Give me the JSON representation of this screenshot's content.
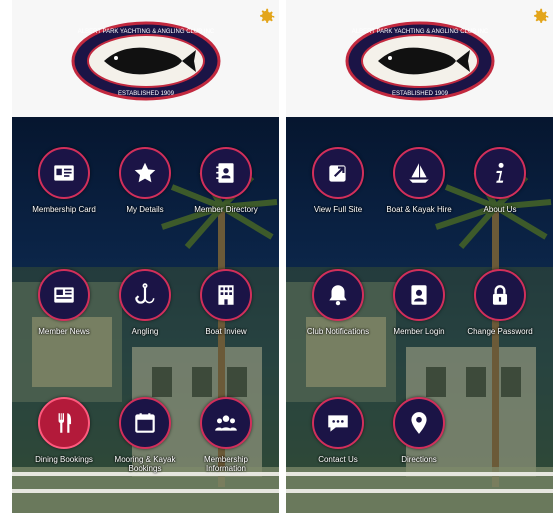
{
  "left_screen": {
    "tiles": [
      {
        "label": "Membership Card",
        "icon": "id-card-icon"
      },
      {
        "label": "My Details",
        "icon": "star-icon"
      },
      {
        "label": "Member Directory",
        "icon": "address-book-icon"
      },
      {
        "label": "Member News",
        "icon": "newspaper-icon"
      },
      {
        "label": "Angling",
        "icon": "fishing-hook-icon"
      },
      {
        "label": "Boat Inview",
        "icon": "building-icon"
      },
      {
        "label": "Dining Bookings",
        "icon": "fork-knife-icon"
      },
      {
        "label": "Mooring & Kayak Bookings",
        "icon": "calendar-icon"
      },
      {
        "label": "Membership Information",
        "icon": "people-icon"
      }
    ]
  },
  "right_screen": {
    "tiles": [
      {
        "label": "View Full Site",
        "icon": "external-link-icon"
      },
      {
        "label": "Boat & Kayak Hire",
        "icon": "sailboat-icon"
      },
      {
        "label": "About Us",
        "icon": "info-icon"
      },
      {
        "label": "Club Notifications",
        "icon": "bell-icon"
      },
      {
        "label": "Member Login",
        "icon": "user-badge-icon"
      },
      {
        "label": "Change Password",
        "icon": "lock-icon"
      },
      {
        "label": "Contact Us",
        "icon": "chat-icon"
      },
      {
        "label": "Directions",
        "icon": "map-pin-icon"
      }
    ]
  },
  "logo": {
    "top_text": "ALBERT PARK YACHTING & ANGLING CLUB INC",
    "bottom_text": "ESTABLISHED 1909"
  },
  "colors": {
    "accent": "#d12f5b",
    "circle": "#1b1446",
    "highlight": "#b31a3a",
    "gear": "#e3a51b"
  }
}
